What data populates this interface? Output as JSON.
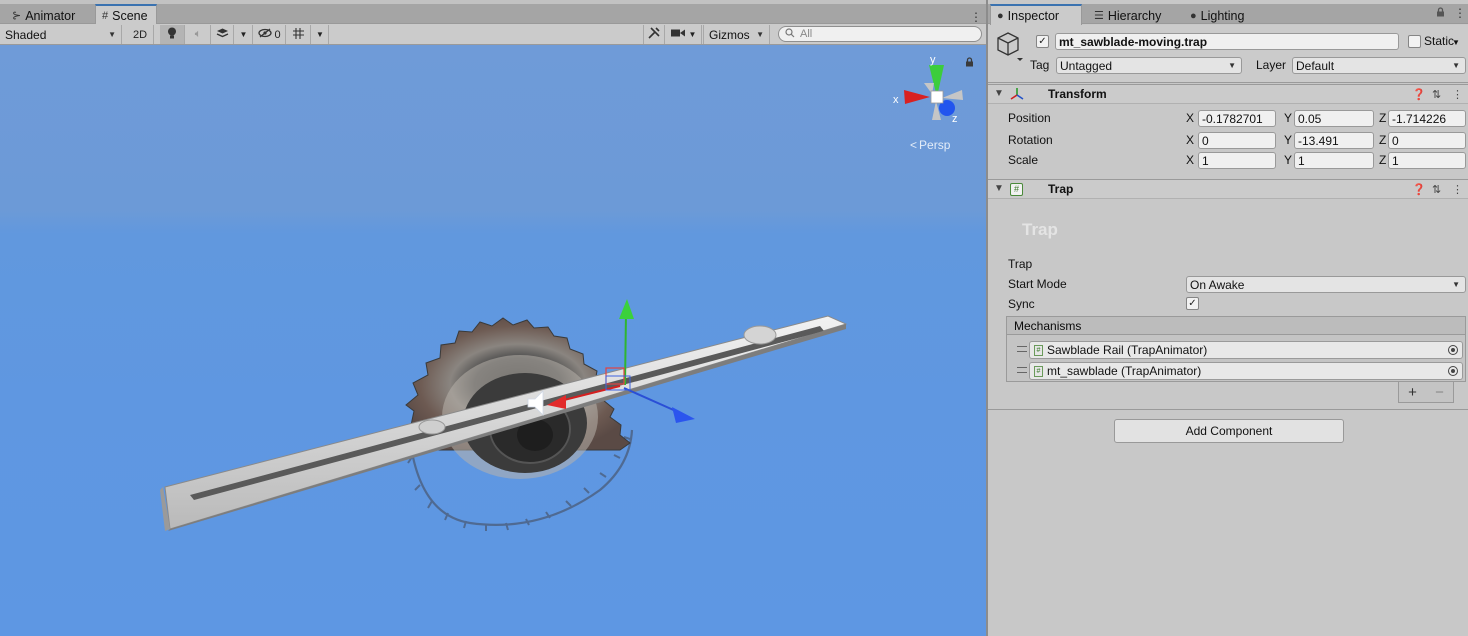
{
  "scene_window": {
    "tabs": [
      {
        "label": "Animator",
        "icon": "animator-icon"
      },
      {
        "label": "Scene",
        "icon": "grid-icon"
      }
    ],
    "toolbar": {
      "draw_mode": "Shaded",
      "mode_2d": "2D",
      "hidden_count": "0",
      "gizmos_label": "Gizmos",
      "search_placeholder": "All"
    },
    "viewport": {
      "persp_label": "Persp",
      "gizmo_axes": {
        "x": "x",
        "y": "y",
        "z": "z"
      },
      "sky_color": "#5f97e1"
    }
  },
  "inspector": {
    "tabs": [
      {
        "label": "Inspector",
        "icon": "info-icon"
      },
      {
        "label": "Hierarchy",
        "icon": "list-icon"
      },
      {
        "label": "Lighting",
        "icon": "bulb-icon"
      }
    ],
    "object": {
      "name": "mt_sawblade-moving.trap",
      "active": true,
      "static_label": "Static",
      "static": false,
      "tag_label": "Tag",
      "tag": "Untagged",
      "layer_label": "Layer",
      "layer": "Default"
    },
    "transform": {
      "title": "Transform",
      "rows": [
        {
          "label": "Position",
          "x": "-0.1782701",
          "y": "0.05",
          "z": "-1.714226"
        },
        {
          "label": "Rotation",
          "x": "0",
          "y": "-13.491",
          "z": "0"
        },
        {
          "label": "Scale",
          "x": "1",
          "y": "1",
          "z": "1"
        }
      ],
      "axis_labels": {
        "x": "X",
        "y": "Y",
        "z": "Z"
      }
    },
    "trap": {
      "title": "Trap",
      "banner": "Trap",
      "section_label": "Trap",
      "start_mode_label": "Start Mode",
      "start_mode": "On Awake",
      "sync_label": "Sync",
      "sync": true,
      "mechanisms_label": "Mechanisms",
      "mechanisms": [
        "Sawblade Rail (TrapAnimator)",
        "mt_sawblade (TrapAnimator)"
      ],
      "add_symbol": "+",
      "remove_symbol": "−"
    },
    "add_component_label": "Add Component"
  }
}
